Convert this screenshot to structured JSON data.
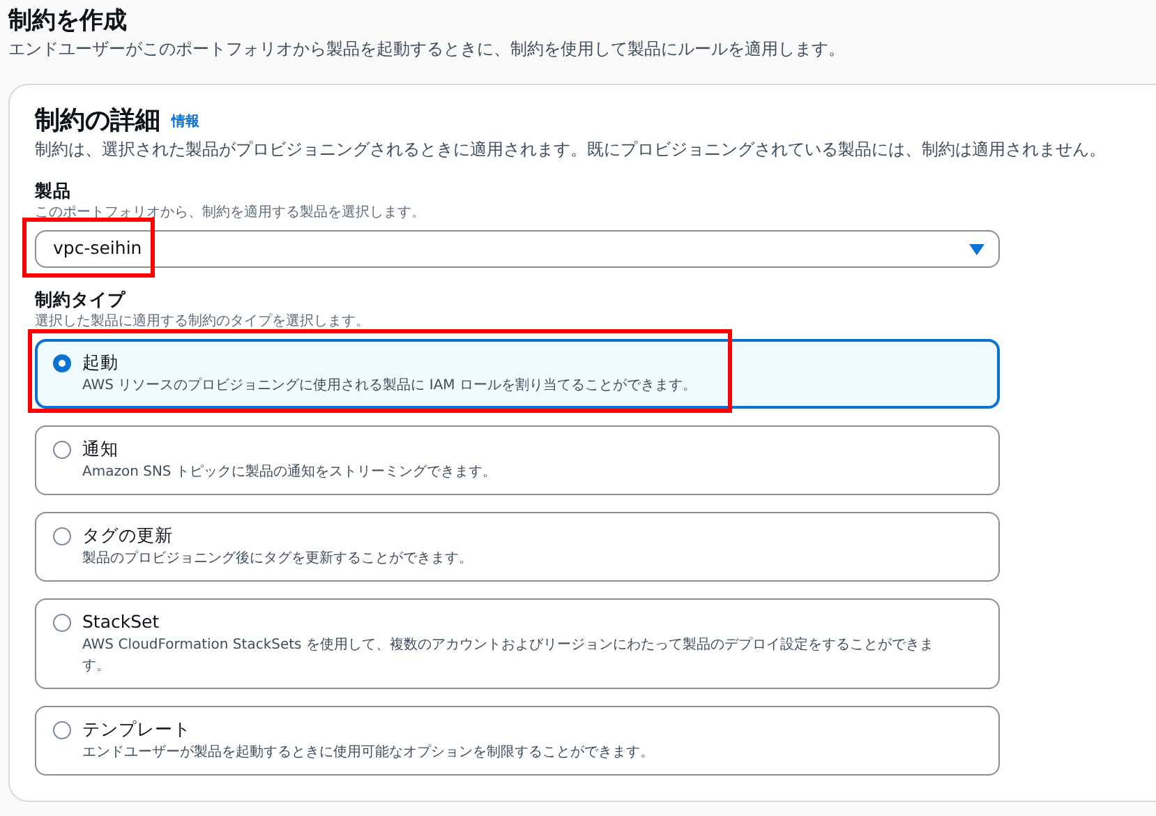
{
  "page": {
    "title": "制約を作成",
    "description": "エンドユーザーがこのポートフォリオから製品を起動するときに、制約を使用して製品にルールを適用します。"
  },
  "panel": {
    "title": "制約の詳細",
    "info_link": "情報",
    "description": "制約は、選択された製品がプロビジョニングされるときに適用されます。既にプロビジョニングされている製品には、制約は適用されません。"
  },
  "product": {
    "label": "製品",
    "hint": "このポートフォリオから、制約を適用する製品を選択します。",
    "value": "vpc-seihin",
    "highlighted": true
  },
  "constraint_type": {
    "label": "制約タイプ",
    "hint": "選択した製品に適用する制約のタイプを選択します。",
    "options": [
      {
        "label": "起動",
        "description": "AWS リソースのプロビジョニングに使用される製品に IAM ロールを割り当てることができます。",
        "selected": true,
        "highlighted": true
      },
      {
        "label": "通知",
        "description": "Amazon SNS トピックに製品の通知をストリーミングできます。",
        "selected": false,
        "highlighted": false
      },
      {
        "label": "タグの更新",
        "description": "製品のプロビジョニング後にタグを更新することができます。",
        "selected": false,
        "highlighted": false
      },
      {
        "label": "StackSet",
        "description": "AWS CloudFormation StackSets を使用して、複数のアカウントおよびリージョンにわたって製品のデプロイ設定をすることができます。",
        "selected": false,
        "highlighted": false
      },
      {
        "label": "テンプレート",
        "description": "エンドユーザーが製品を起動するときに使用可能なオプションを制限することができます。",
        "selected": false,
        "highlighted": false
      }
    ]
  }
}
